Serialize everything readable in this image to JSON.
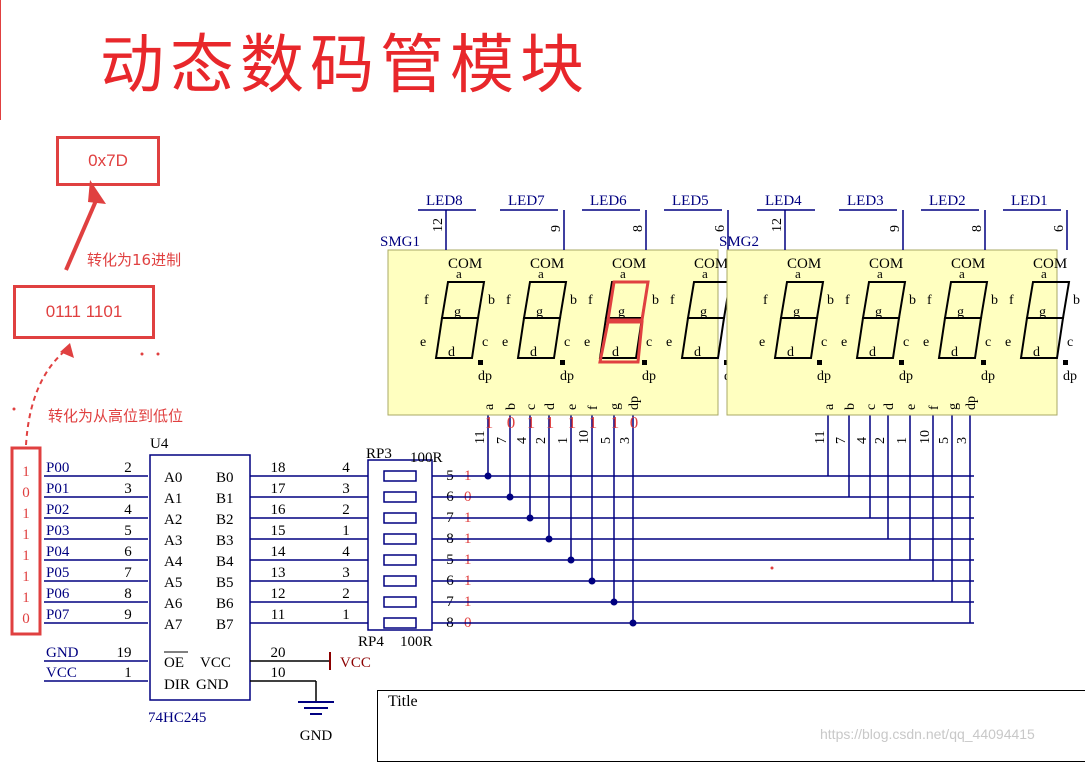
{
  "header": {
    "title": "动态数码管模块"
  },
  "annotations": {
    "hex_value": "0x7D",
    "binary_value": "0111 1101",
    "to_hex_note": "转化为16进制",
    "high_to_low_note": "转化为从高位到低位",
    "bits_column": [
      "1",
      "0",
      "1",
      "1",
      "1",
      "1",
      "1",
      "0"
    ],
    "segment_bits": [
      "1",
      "0",
      "1",
      "1",
      "1",
      "1",
      "1",
      "0"
    ],
    "rp_right_bits": [
      "1",
      "0",
      "1",
      "1",
      "1",
      "1",
      "1",
      "0"
    ]
  },
  "chip": {
    "designator": "U4",
    "part": "74HC245",
    "left_nets": [
      "P00",
      "P01",
      "P02",
      "P03",
      "P04",
      "P05",
      "P06",
      "P07"
    ],
    "left_pin_nums": [
      "2",
      "3",
      "4",
      "5",
      "6",
      "7",
      "8",
      "9"
    ],
    "a_pins": [
      "A0",
      "A1",
      "A2",
      "A3",
      "A4",
      "A5",
      "A6",
      "A7"
    ],
    "b_pins": [
      "B0",
      "B1",
      "B2",
      "B3",
      "B4",
      "B5",
      "B6",
      "B7"
    ],
    "right_pin_nums": [
      "18",
      "17",
      "16",
      "15",
      "14",
      "13",
      "12",
      "11"
    ],
    "oe_net": "GND",
    "oe_num": "19",
    "oe_label": "OE",
    "dir_net": "VCC",
    "dir_num": "1",
    "dir_label": "DIR",
    "vcc_num": "20",
    "vcc_label": "VCC",
    "vcc_net": "VCC",
    "gnd_num": "10",
    "gnd_label": "GND",
    "gnd_net": "GND"
  },
  "resistors": {
    "rp3": "RP3",
    "rp3_value": "100R",
    "rp4": "RP4",
    "rp4_value": "100R",
    "left_pins": [
      "4",
      "3",
      "2",
      "1",
      "4",
      "3",
      "2",
      "1"
    ],
    "right_pins": [
      "5",
      "6",
      "7",
      "8",
      "5",
      "6",
      "7",
      "8"
    ]
  },
  "displays": [
    {
      "name": "SMG1",
      "leds": [
        "LED8",
        "LED7",
        "LED6",
        "LED5"
      ],
      "com_pins": [
        "12",
        "9",
        "8",
        "6"
      ],
      "seg_names": [
        "a",
        "b",
        "c",
        "d",
        "e",
        "f",
        "g",
        "dp"
      ],
      "seg_pins": [
        "11",
        "7",
        "4",
        "2",
        "1",
        "10",
        "5",
        "3"
      ]
    },
    {
      "name": "SMG2",
      "leds": [
        "LED4",
        "LED3",
        "LED2",
        "LED1"
      ],
      "com_pins": [
        "12",
        "9",
        "8",
        "6"
      ],
      "seg_names": [
        "a",
        "b",
        "c",
        "d",
        "e",
        "f",
        "g",
        "dp"
      ],
      "seg_pins": [
        "11",
        "7",
        "4",
        "2",
        "1",
        "10",
        "5",
        "3"
      ]
    }
  ],
  "digit_labels": {
    "com": "COM",
    "a": "a",
    "b": "b",
    "c": "c",
    "d": "d",
    "e": "e",
    "f": "f",
    "g": "g",
    "dp": "dp"
  },
  "title_block": {
    "label": "Title"
  },
  "watermark": "https://blog.csdn.net/qq_44094415",
  "colors": {
    "annotation": "#e04040",
    "net_label": "#000080",
    "wire": "#000080",
    "display_fill": "#ffffc0"
  }
}
